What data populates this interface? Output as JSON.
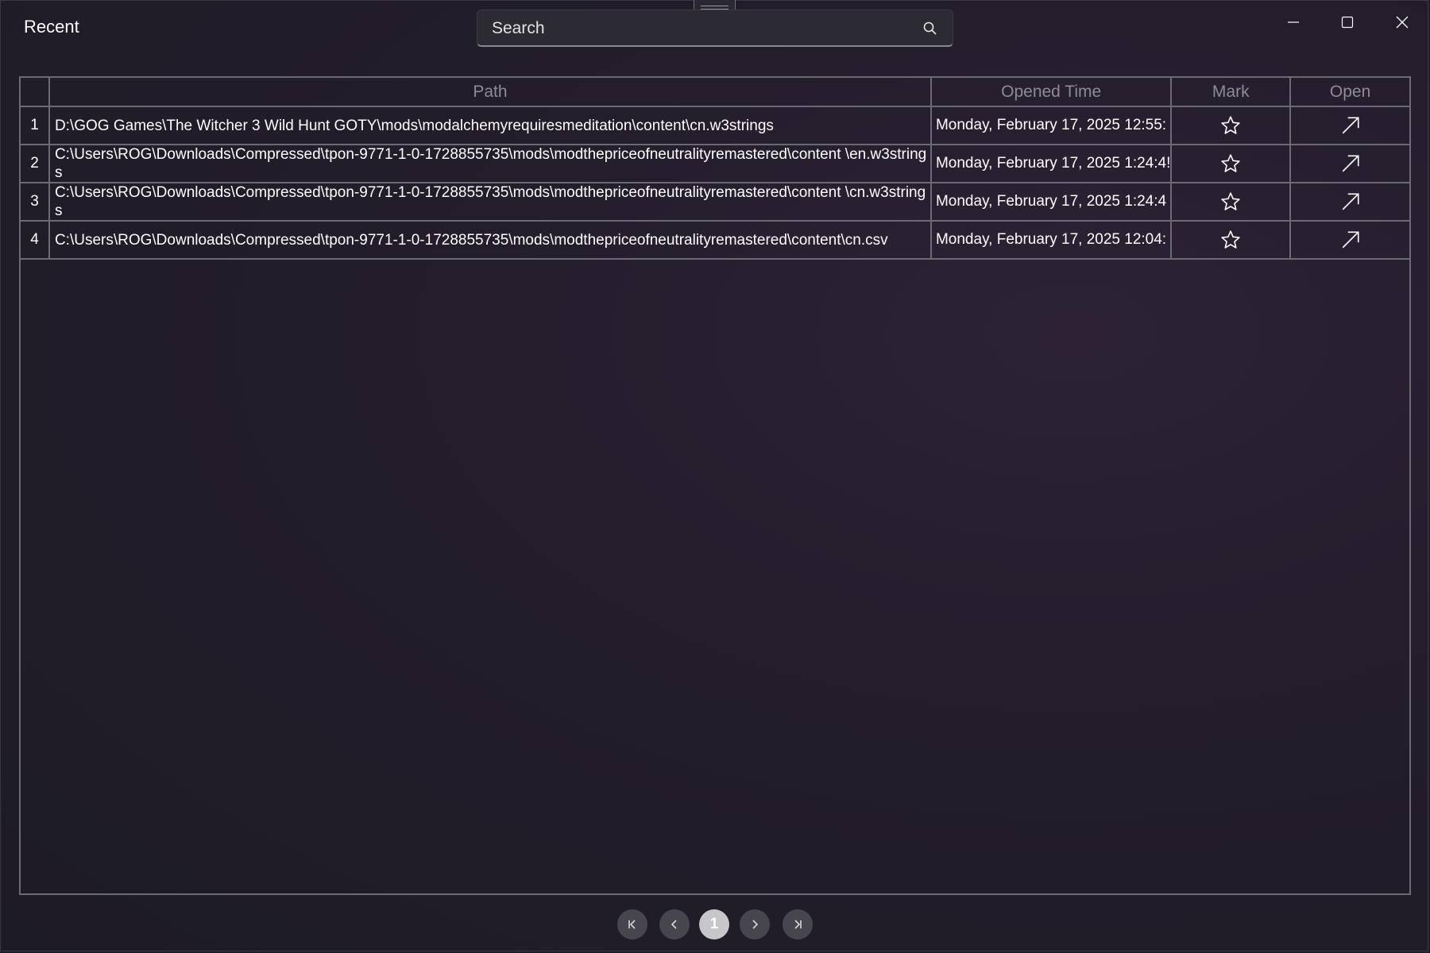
{
  "window": {
    "title": "Recent"
  },
  "search": {
    "placeholder": "Search",
    "value": ""
  },
  "table": {
    "columns": {
      "index": "",
      "path": "Path",
      "opened_time": "Opened Time",
      "mark": "Mark",
      "open": "Open"
    },
    "rows": [
      {
        "index": "1",
        "path": "D:\\GOG Games\\The Witcher 3 Wild Hunt GOTY\\mods\\modalchemyrequiresmeditation\\content\\cn.w3strings",
        "opened_time": "Monday, February 17, 2025 12:55:",
        "mark_icon": "star-outline-icon",
        "open_icon": "arrow-up-right-icon"
      },
      {
        "index": "2",
        "path": "C:\\Users\\ROG\\Downloads\\Compressed\\tpon-9771-1-0-1728855735\\mods\\modthepriceofneutralityremastered\\content \\en.w3strings",
        "opened_time": "Monday, February 17, 2025 1:24:4!",
        "mark_icon": "star-outline-icon",
        "open_icon": "arrow-up-right-icon"
      },
      {
        "index": "3",
        "path": "C:\\Users\\ROG\\Downloads\\Compressed\\tpon-9771-1-0-1728855735\\mods\\modthepriceofneutralityremastered\\content \\cn.w3strings",
        "opened_time": "Monday, February 17, 2025 1:24:4",
        "mark_icon": "star-outline-icon",
        "open_icon": "arrow-up-right-icon"
      },
      {
        "index": "4",
        "path": "C:\\Users\\ROG\\Downloads\\Compressed\\tpon-9771-1-0-1728855735\\mods\\modthepriceofneutralityremastered\\content\\cn.csv",
        "opened_time": "Monday, February 17, 2025 12:04:",
        "mark_icon": "star-outline-icon",
        "open_icon": "arrow-up-right-icon"
      }
    ]
  },
  "pagination": {
    "current_page": "1",
    "buttons": [
      "first-page-icon",
      "previous-page-icon",
      "next-page-icon",
      "last-page-icon"
    ]
  },
  "colors": {
    "background": "#211d29",
    "grid_line": "#6c6a72",
    "header_text": "#8d8b93",
    "cell_text": "#ffffff",
    "page_button": "#47454d",
    "current_page": "#c7c6cb"
  }
}
